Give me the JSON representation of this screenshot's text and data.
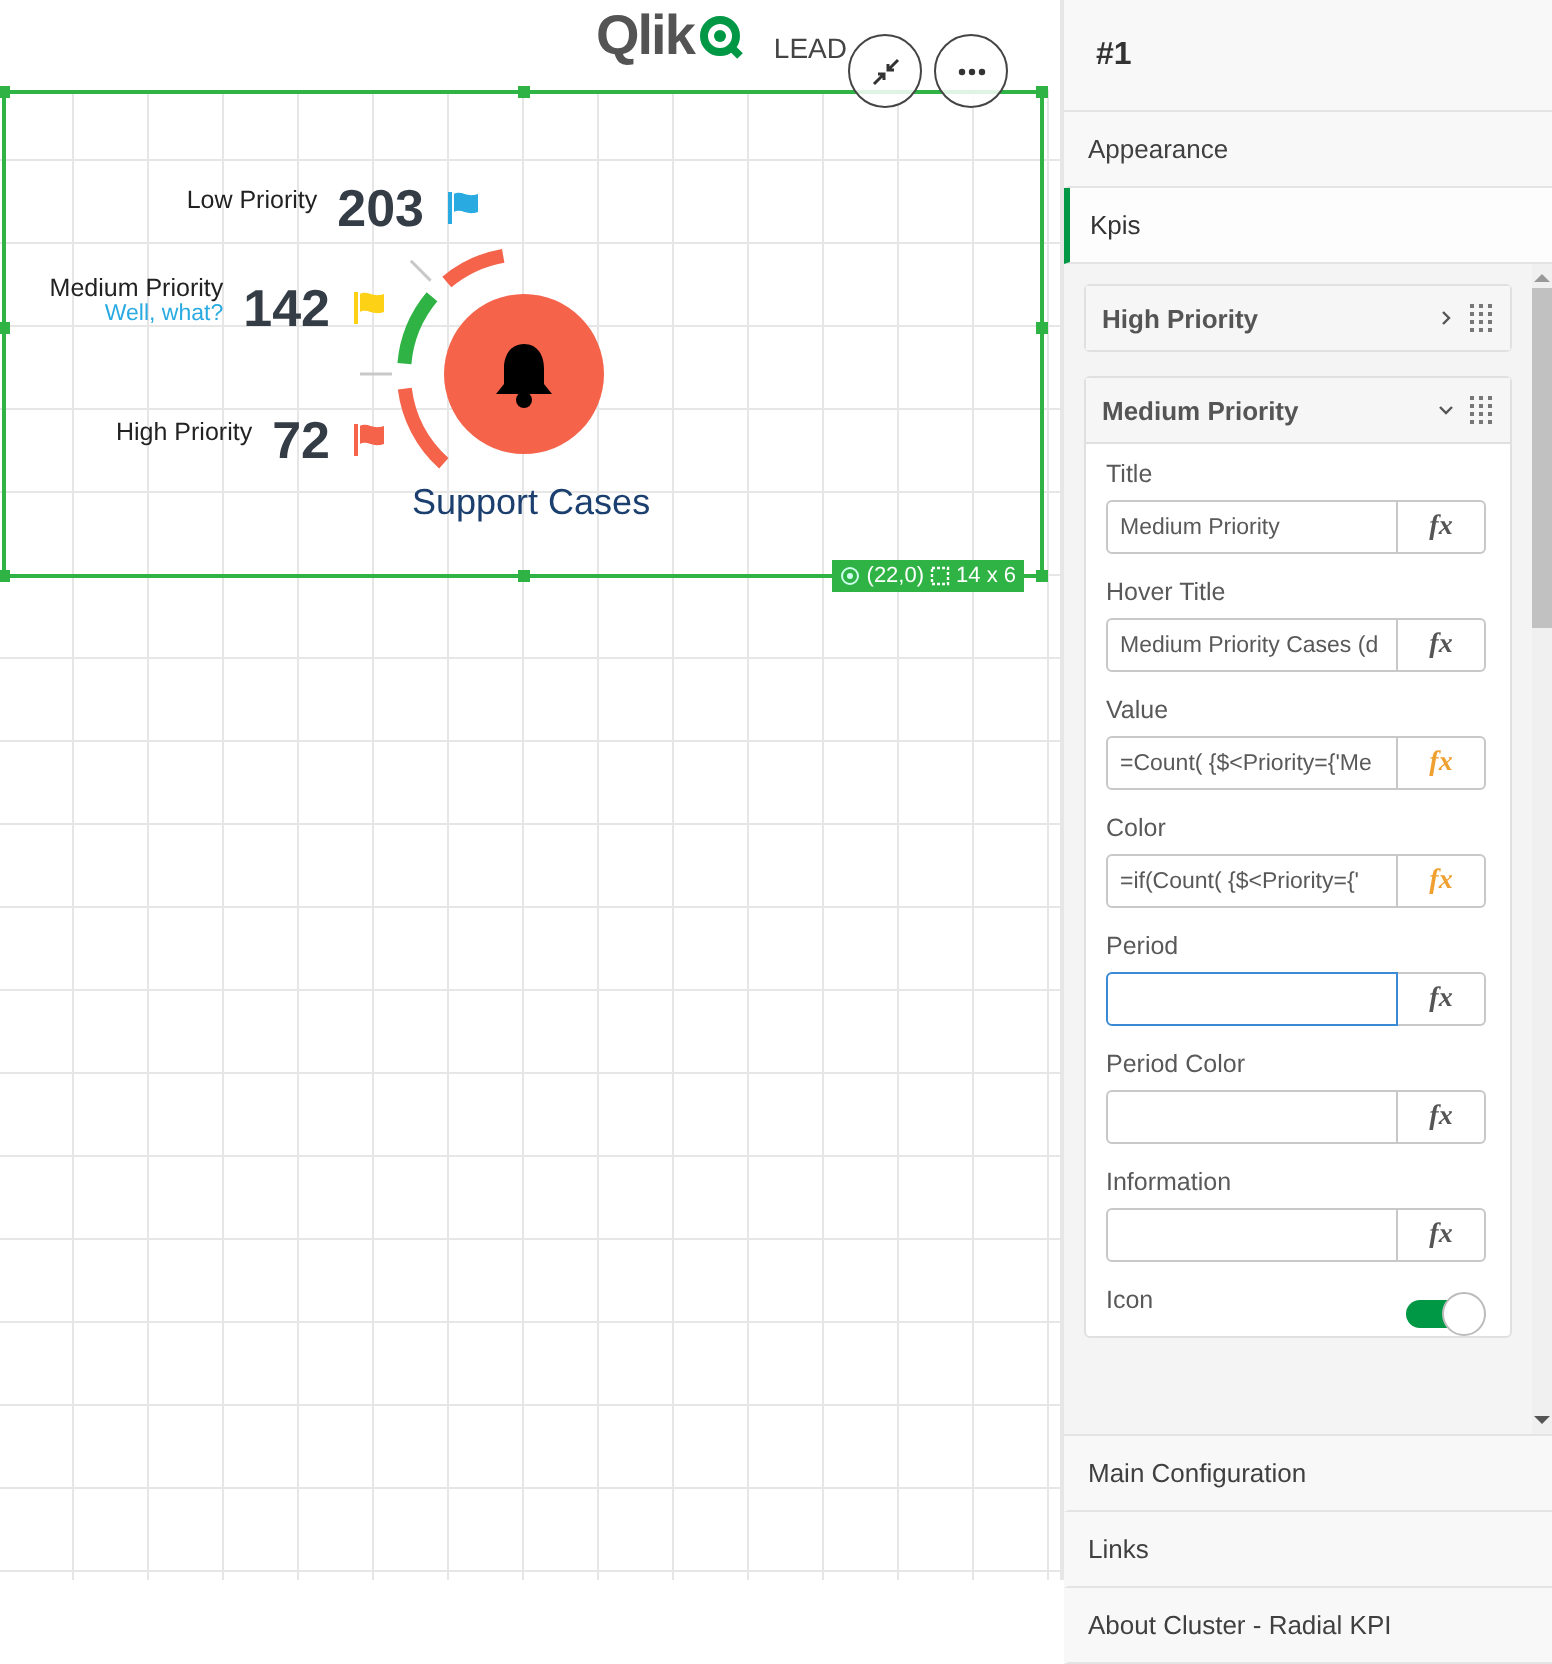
{
  "header": {
    "logo_text": "Qlik",
    "title": "LEAD"
  },
  "object_buttons": [
    {
      "kind": "exit"
    },
    {
      "kind": "more"
    }
  ],
  "kpi": {
    "title": "Support Cases",
    "items": [
      {
        "label": "Low Priority",
        "value": "203",
        "color": "#29abe2"
      },
      {
        "label": "Medium Priority",
        "sublabel": "Well, what?",
        "value": "142",
        "color": "#fcd116"
      },
      {
        "label": "High Priority",
        "value": "72",
        "color": "#f5634a"
      }
    ],
    "segments": [
      {
        "color": "#f5634a"
      },
      {
        "color": "#2fb344"
      },
      {
        "color": "#f5634a"
      }
    ]
  },
  "object_badge": {
    "position": "(22,0)",
    "size": "14 x 6"
  },
  "panel": {
    "title": "#1",
    "sections_top": [
      {
        "label": "Appearance",
        "selected": false
      },
      {
        "label": "Kpis",
        "selected": true
      }
    ],
    "cards": [
      {
        "title": "High Priority",
        "expanded": false
      },
      {
        "title": "Medium Priority",
        "expanded": true,
        "fields": [
          {
            "label": "Title",
            "value": "Medium Priority",
            "fx": "fx",
            "fx_active": false,
            "focused": false
          },
          {
            "label": "Hover Title",
            "value": "Medium Priority Cases (d",
            "fx": "fx",
            "fx_active": false,
            "focused": false
          },
          {
            "label": "Value",
            "value": "=Count( {$<Priority={'Me",
            "fx": "fx",
            "fx_active": true,
            "focused": false
          },
          {
            "label": "Color",
            "value": "=if(Count( {$<Priority={'",
            "fx": "fx",
            "fx_active": true,
            "focused": false
          },
          {
            "label": "Period",
            "fx": "fx",
            "fx_active": false,
            "focused": true
          },
          {
            "label": "Period Color",
            "fx": "fx",
            "fx_active": false,
            "focused": false
          },
          {
            "label": "Information",
            "fx": "fx",
            "fx_active": false,
            "focused": false
          }
        ],
        "toggle": {
          "label": "Icon",
          "on": true
        }
      }
    ],
    "sections_bottom": [
      {
        "label": "Main Configuration",
        "selected": false
      },
      {
        "label": "Links",
        "selected": false
      },
      {
        "label": "About Cluster - Radial KPI",
        "selected": false
      }
    ]
  }
}
